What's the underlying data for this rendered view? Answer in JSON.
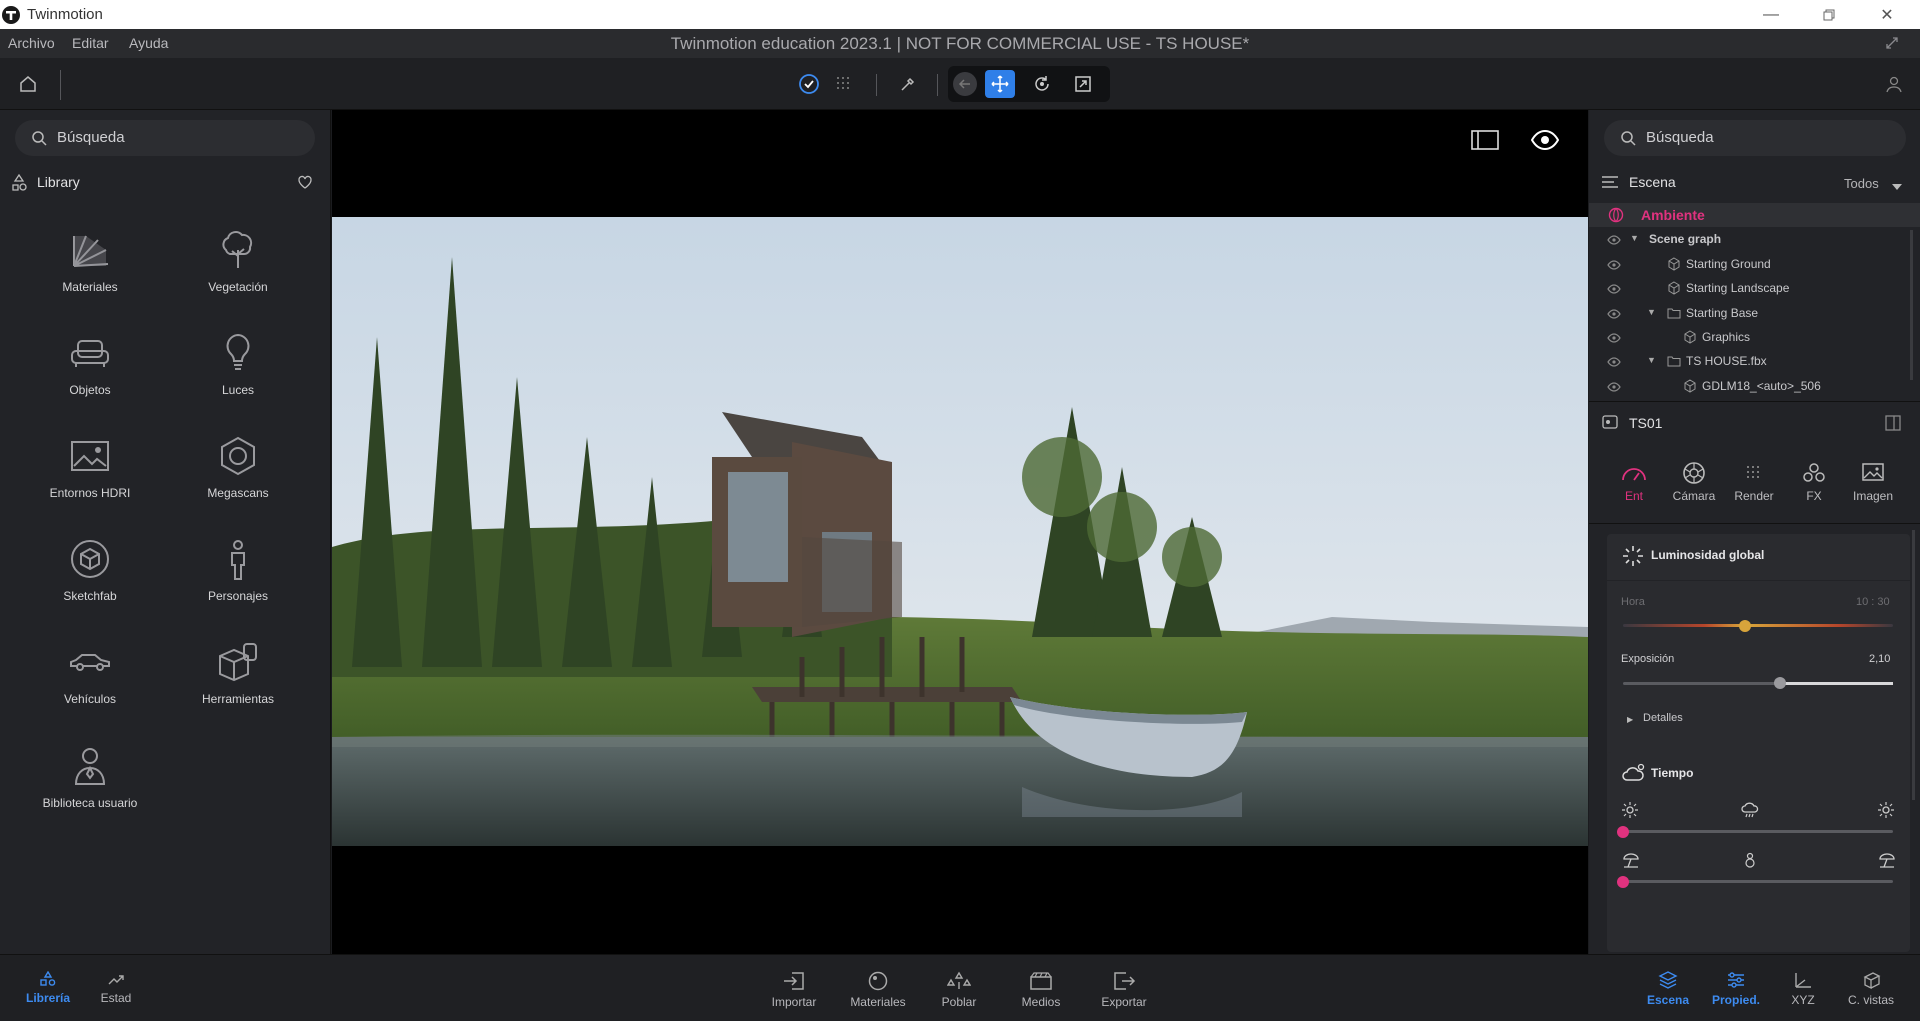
{
  "window": {
    "app_name": "Twinmotion",
    "document_title": "Twinmotion education 2023.1 | NOT FOR COMMERCIAL USE - TS HOUSE*"
  },
  "menu": [
    "Archivo",
    "Editar",
    "Ayuda"
  ],
  "left_panel": {
    "search_placeholder": "Búsqueda",
    "library_title": "Library",
    "items": [
      {
        "label": "Materiales",
        "icon": "material-fan-icon"
      },
      {
        "label": "Vegetación",
        "icon": "tree-icon"
      },
      {
        "label": "Objetos",
        "icon": "sofa-icon"
      },
      {
        "label": "Luces",
        "icon": "lightbulb-icon"
      },
      {
        "label": "Entornos HDRI",
        "icon": "hdri-image-icon"
      },
      {
        "label": "Megascans",
        "icon": "megascans-icon"
      },
      {
        "label": "Sketchfab",
        "icon": "sketchfab-cube-icon"
      },
      {
        "label": "Personajes",
        "icon": "person-icon"
      },
      {
        "label": "Vehículos",
        "icon": "car-icon"
      },
      {
        "label": "Herramientas",
        "icon": "tools-box-icon"
      },
      {
        "label": "Biblioteca usuario",
        "icon": "user-library-icon"
      }
    ]
  },
  "right_panel": {
    "search_placeholder": "Búsqueda",
    "scene_title": "Escena",
    "filter_label": "Todos",
    "ambiente_label": "Ambiente",
    "tree": [
      {
        "label": "Scene graph",
        "bold": true,
        "expanded": true
      },
      {
        "label": "Starting Ground"
      },
      {
        "label": "Starting Landscape"
      },
      {
        "label": "Starting Base",
        "expanded": true,
        "folder": true
      },
      {
        "label": "Graphics"
      },
      {
        "label": "TS HOUSE.fbx",
        "expanded": true,
        "folder": true
      },
      {
        "label": "GDLM18_<auto>_506"
      }
    ],
    "props_title": "TS01",
    "tabs": [
      "Ent",
      "Cámara",
      "Render",
      "FX",
      "Imagen"
    ],
    "active_tab": "Ent",
    "global_light": {
      "title": "Luminosidad global",
      "hour_label": "Hora",
      "hour_value": "10 : 30",
      "hour_position": 0.45,
      "exposure_label": "Exposición",
      "exposure_value": "2,10",
      "exposure_position": 0.58,
      "details_label": "Detalles"
    },
    "weather": {
      "title": "Tiempo",
      "slider1_position": 0.0,
      "slider2_position": 0.0
    }
  },
  "bottom": {
    "left": [
      {
        "label": "Librería",
        "active": true
      },
      {
        "label": "Estad",
        "active": false
      }
    ],
    "center": [
      "Importar",
      "Materiales",
      "Poblar",
      "Medios",
      "Exportar"
    ],
    "right": [
      {
        "label": "Escena",
        "active": true
      },
      {
        "label": "Propied.",
        "active": true
      },
      {
        "label": "XYZ",
        "active": false
      },
      {
        "label": "C. vistas",
        "active": false
      }
    ]
  },
  "colors": {
    "accent_blue": "#3d8bf0",
    "accent_pink": "#e0327f",
    "panel": "#222327"
  }
}
